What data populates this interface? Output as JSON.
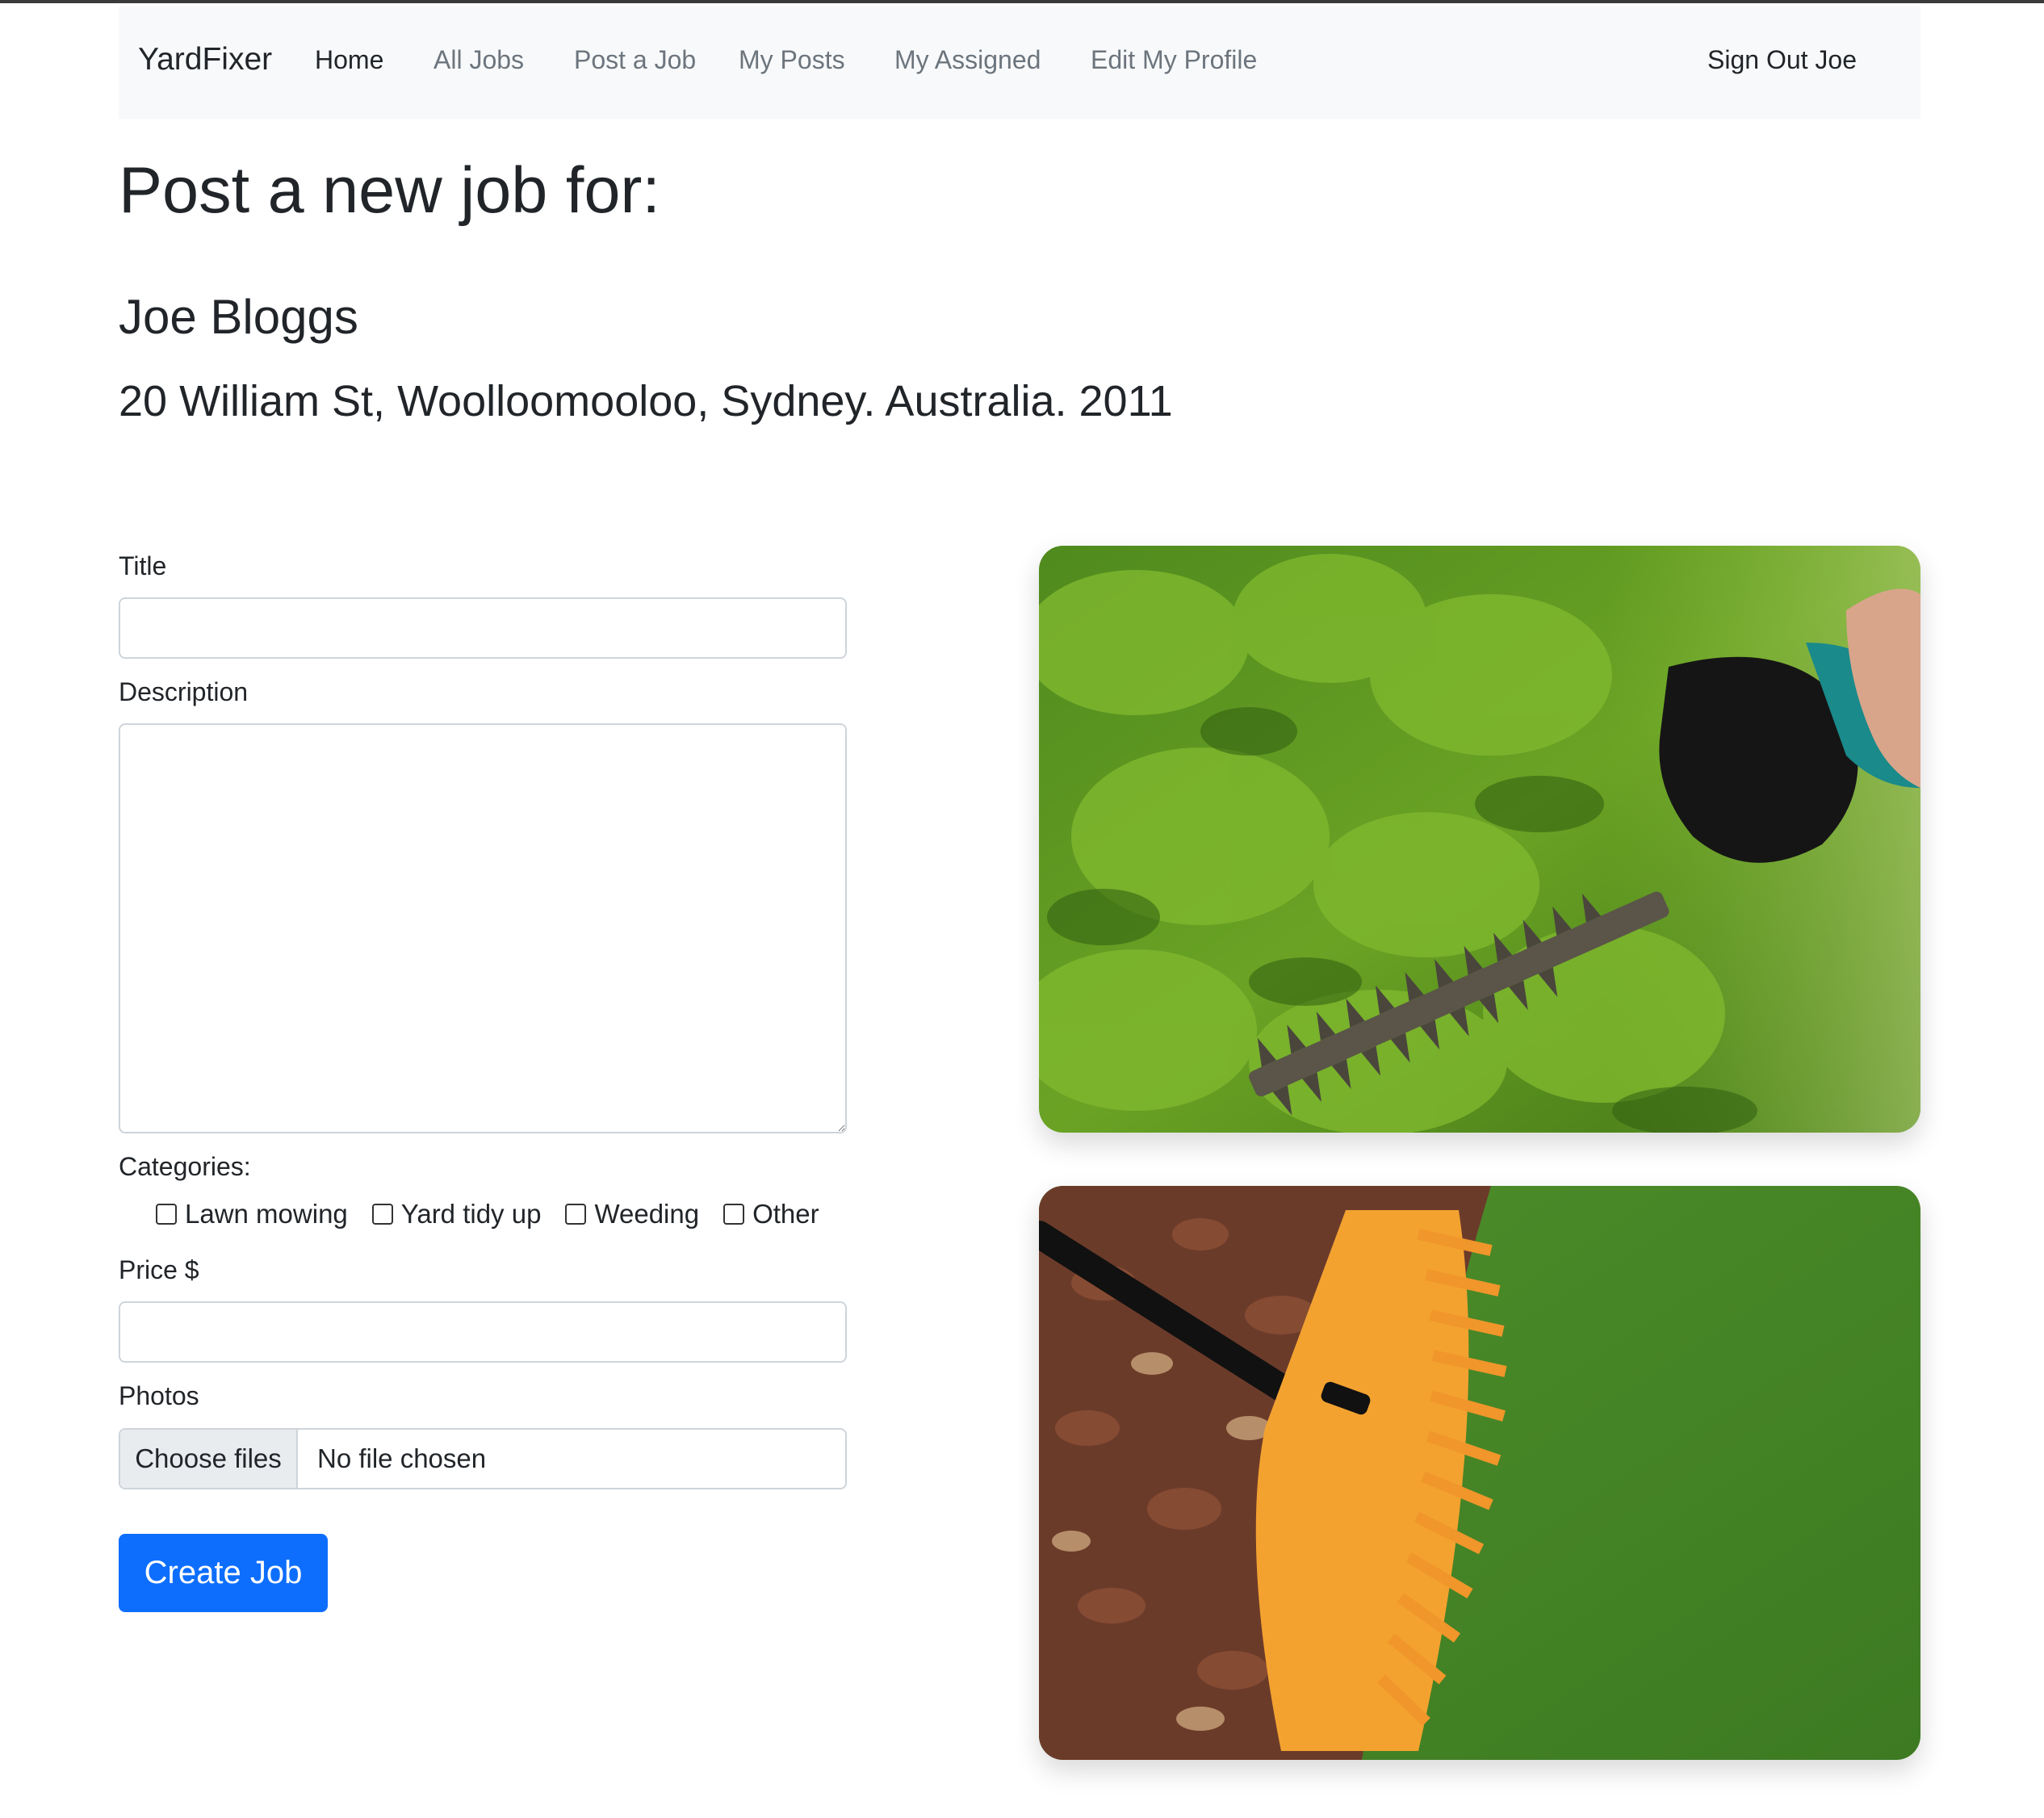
{
  "navbar": {
    "brand": "YardFixer",
    "links": [
      {
        "label": "Home"
      },
      {
        "label": "All Jobs"
      },
      {
        "label": "Post a Job"
      },
      {
        "label": "My Posts"
      },
      {
        "label": "My Assigned"
      },
      {
        "label": "Edit My Profile"
      }
    ],
    "sign_out": "Sign Out Joe"
  },
  "header": {
    "title": "Post a new job for:",
    "name": "Joe Bloggs",
    "address": "20 William St, Woolloomooloo, Sydney. Australia. 2011"
  },
  "form": {
    "title_label": "Title",
    "title_value": "",
    "description_label": "Description",
    "description_value": "",
    "categories_label": "Categories:",
    "categories": [
      {
        "label": "Lawn mowing",
        "checked": false
      },
      {
        "label": "Yard tidy up",
        "checked": false
      },
      {
        "label": "Weeding",
        "checked": false
      },
      {
        "label": "Other",
        "checked": false
      }
    ],
    "price_label": "Price $",
    "price_value": "",
    "photos_label": "Photos",
    "choose_files": "Choose files",
    "no_file": "No file chosen",
    "submit": "Create Job"
  },
  "colors": {
    "primary": "#0d6efd",
    "navbar_bg": "#f8f9fa",
    "muted_link": "#6c757d"
  }
}
